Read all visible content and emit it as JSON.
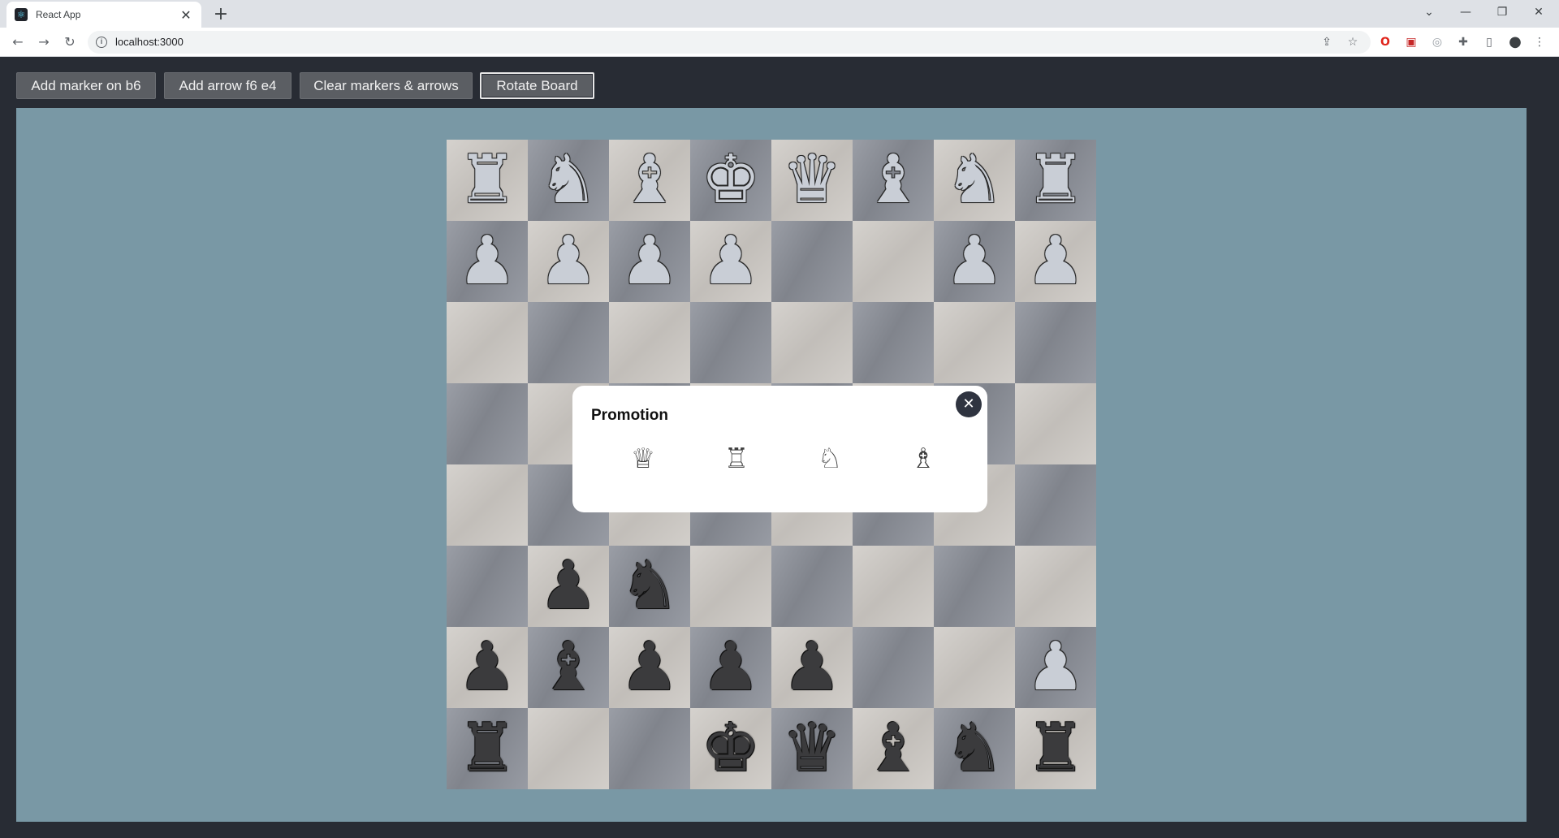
{
  "browser": {
    "tab_title": "React App",
    "tab_close": "✕",
    "new_tab": "+",
    "favicon": "⚛",
    "url": "localhost:3000",
    "controls": {
      "tabsearch": "⌄",
      "minimize": "—",
      "restore": "❐",
      "close": "✕"
    },
    "nav": {
      "back": "←",
      "forward": "→",
      "reload": "↻"
    },
    "info": "i",
    "toolbar_icons": {
      "share": "⇪",
      "star": "☆",
      "opera": "O",
      "ext1": "▣",
      "compass": "◎",
      "puzzle": "✚",
      "sidepanel": "▯",
      "profile": "●",
      "menu": "⋮"
    }
  },
  "buttons": [
    {
      "label": "Add marker on b6"
    },
    {
      "label": "Add arrow f6 e4"
    },
    {
      "label": "Clear markers & arrows"
    },
    {
      "label": "Rotate Board"
    }
  ],
  "board": {
    "rows": [
      [
        "wr",
        "wn",
        "wb",
        "wk",
        "wq",
        "wb",
        "wn",
        "wr"
      ],
      [
        "wp",
        "wp",
        "wp",
        "wp",
        "",
        "",
        "wp",
        "wp"
      ],
      [
        "",
        "",
        "",
        "",
        "",
        "",
        "",
        ""
      ],
      [
        "",
        "",
        "",
        "",
        "",
        "",
        "",
        ""
      ],
      [
        "",
        "",
        "",
        "",
        "",
        "",
        "",
        ""
      ],
      [
        "",
        "bp",
        "bn",
        "",
        "",
        "",
        "",
        ""
      ],
      [
        "bp",
        "bb",
        "bp",
        "bp",
        "bp",
        "",
        "",
        "wp"
      ],
      [
        "br",
        "",
        "",
        "bk",
        "bq",
        "bb",
        "bn",
        "br"
      ]
    ],
    "glyphs": {
      "k": "♚",
      "q": "♛",
      "r": "♜",
      "b": "♝",
      "n": "♞",
      "p": "♟"
    },
    "colors": {
      "light": "#ccc8c3",
      "dark": "#8f939c",
      "background": "#7998a5"
    }
  },
  "promotion": {
    "title": "Promotion",
    "close": "✕",
    "pieces": [
      {
        "name": "queen",
        "glyph": "♕"
      },
      {
        "name": "rook",
        "glyph": "♖"
      },
      {
        "name": "knight",
        "glyph": "♘"
      },
      {
        "name": "bishop",
        "glyph": "♗"
      }
    ]
  }
}
